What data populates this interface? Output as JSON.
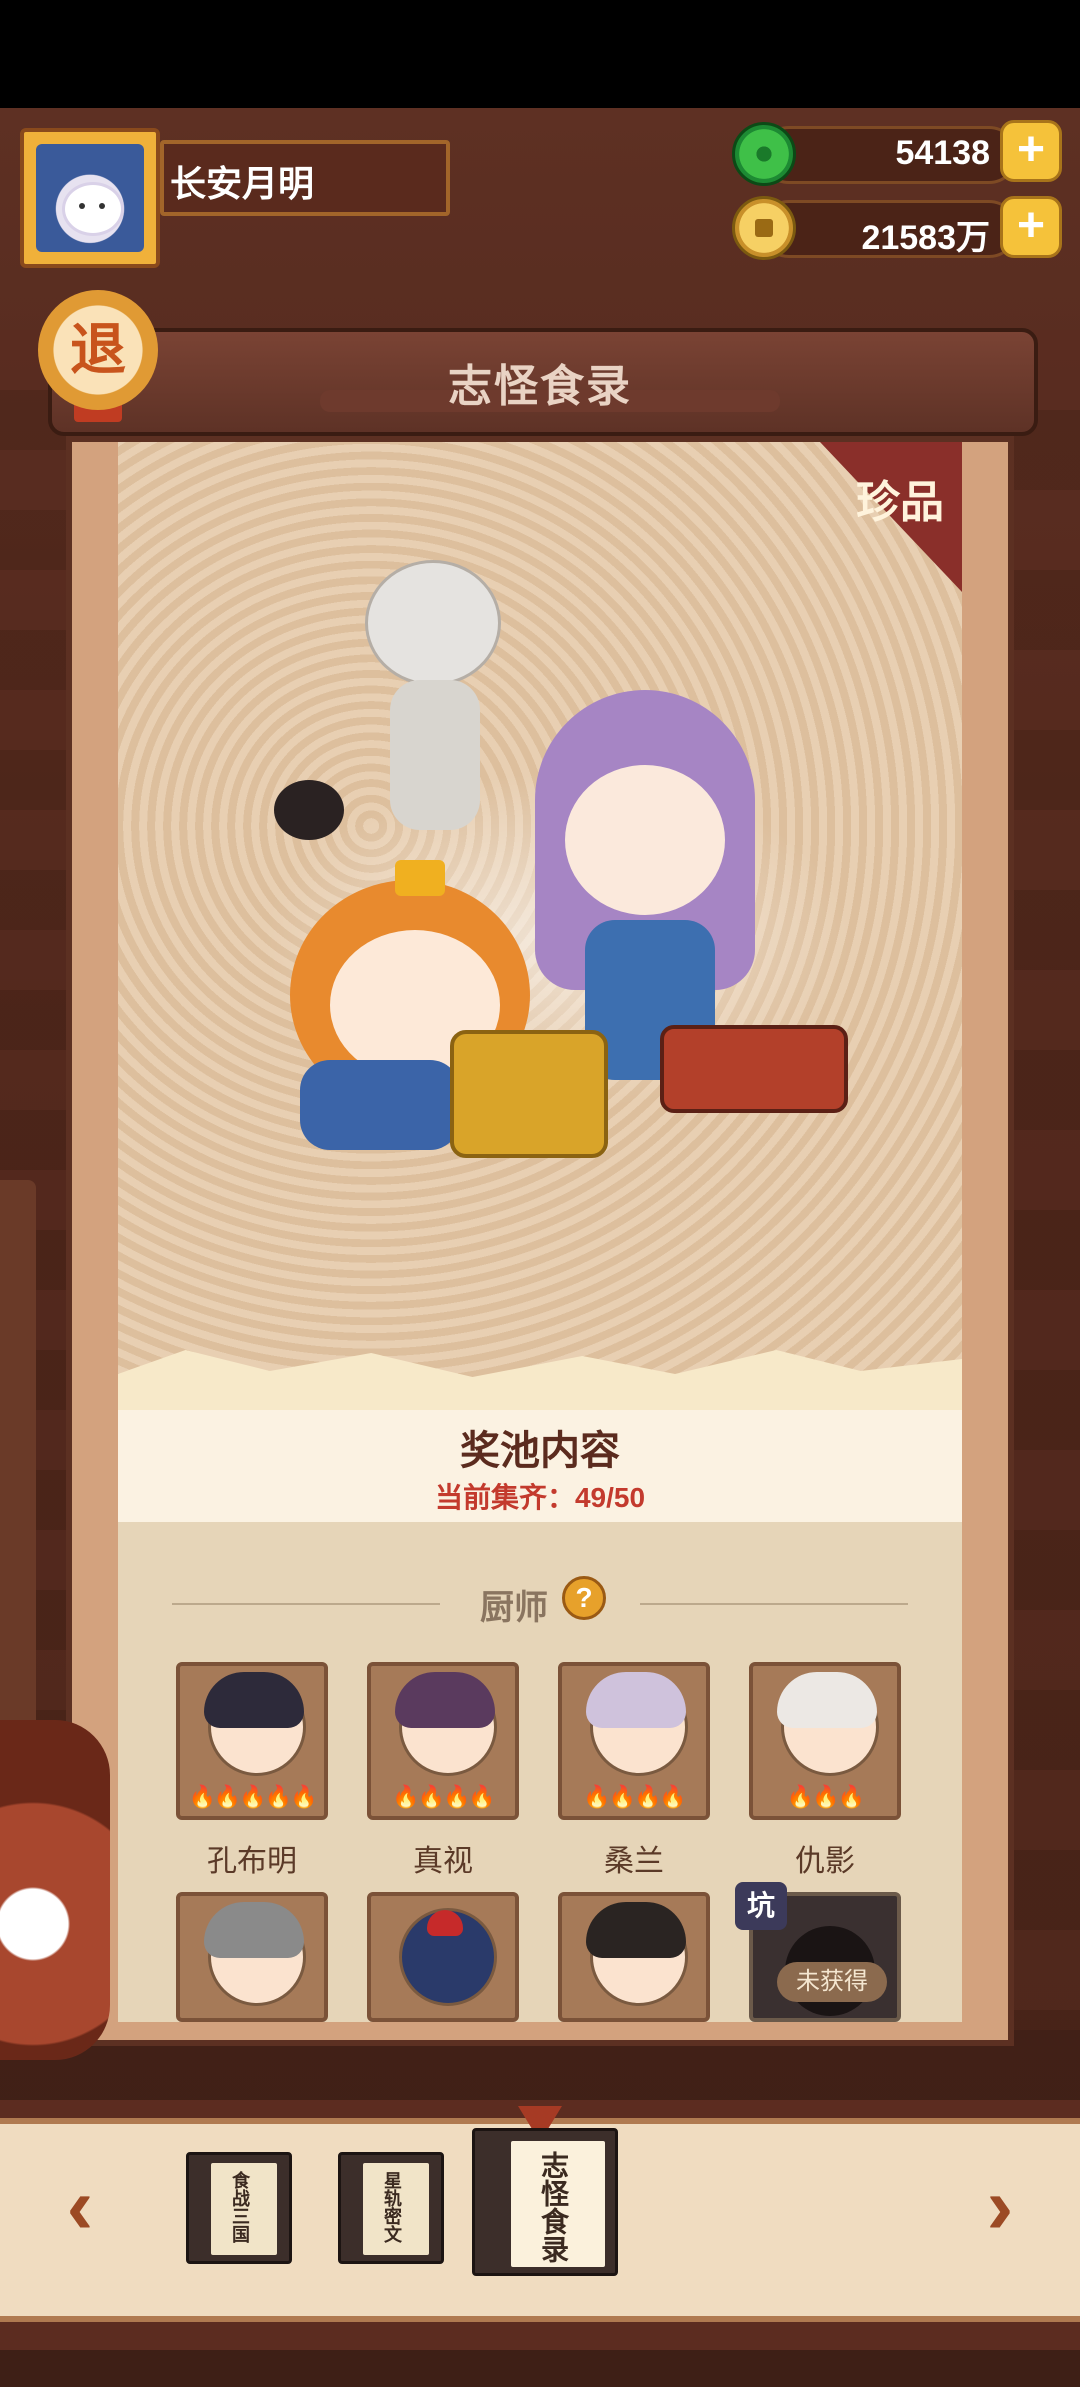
{
  "player": {
    "name": "长安月明"
  },
  "currency": {
    "jade": "54138",
    "coins": "21583万",
    "plus_label": "+"
  },
  "buttons": {
    "retreat": "退"
  },
  "header": {
    "title": "志怪食录"
  },
  "banner": {
    "rarity": "珍品"
  },
  "pool": {
    "title": "奖池内容",
    "progress": "当前集齐：49/50"
  },
  "section": {
    "chefs_label": "厨师",
    "help": "?"
  },
  "chefs": [
    {
      "name": "孔布明",
      "flames": "🔥🔥🔥🔥🔥",
      "hair": "#2d2a3a"
    },
    {
      "name": "真视",
      "flames": "🔥🔥🔥🔥",
      "hair": "#5a3a5e"
    },
    {
      "name": "桑兰",
      "flames": "🔥🔥🔥🔥",
      "hair": "#cfc2dc"
    },
    {
      "name": "仇影",
      "flames": "🔥🔥🔥",
      "hair": "#ece8e4"
    },
    {
      "name": "",
      "flames": "",
      "hair": "#8a8a8a"
    },
    {
      "name": "",
      "flames": "",
      "hair": "#2a3a6a"
    },
    {
      "name": "",
      "flames": "",
      "hair": "#2a2422"
    },
    {
      "name": "",
      "locked": true,
      "status": "未获得",
      "tag": "坑"
    }
  ],
  "bottom_nav": {
    "prev": "‹",
    "next": "›",
    "books": [
      {
        "label": "食战三国",
        "active": false
      },
      {
        "label": "星轨密文",
        "active": false
      },
      {
        "label": "志怪食录",
        "active": true
      }
    ]
  },
  "colors": {
    "accent": "#f5c23a",
    "highlight_red": "#c33a2d",
    "panel_brown": "#5c3022"
  }
}
